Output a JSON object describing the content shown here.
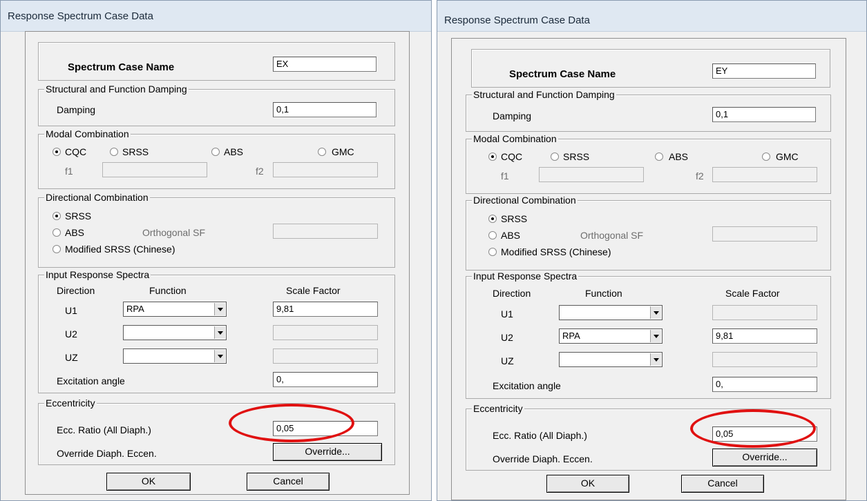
{
  "left_dialog": {
    "title": "Response Spectrum Case Data",
    "case_name_label": "Spectrum Case Name",
    "case_name_value": "EX",
    "damping_group": "Structural and Function Damping",
    "damping_label": "Damping",
    "damping_value": "0,1",
    "modal_group": "Modal Combination",
    "modal_options": [
      "CQC",
      "SRSS",
      "ABS",
      "GMC"
    ],
    "modal_selected": "CQC",
    "f1_label": "f1",
    "f2_label": "f2",
    "directional_group": "Directional Combination",
    "directional_options": [
      "SRSS",
      "ABS",
      "Modified SRSS (Chinese)"
    ],
    "directional_selected": "SRSS",
    "orthogonal_sf_label": "Orthogonal SF",
    "input_group": "Input Response Spectra",
    "col_direction": "Direction",
    "col_function": "Function",
    "col_scale": "Scale Factor",
    "rows": [
      {
        "dir": "U1",
        "function": "RPA",
        "scale": "9,81"
      },
      {
        "dir": "U2",
        "function": "",
        "scale": ""
      },
      {
        "dir": "UZ",
        "function": "",
        "scale": ""
      }
    ],
    "excitation_label": "Excitation  angle",
    "excitation_value": "0,",
    "ecc_group": "Eccentricity",
    "ecc_ratio_label": "Ecc. Ratio (All Diaph.)",
    "ecc_ratio_value": "0,05",
    "override_label": "Override Diaph. Eccen.",
    "override_button": "Override...",
    "ok_button": "OK",
    "cancel_button": "Cancel"
  },
  "right_dialog": {
    "title": "Response Spectrum Case Data",
    "case_name_label": "Spectrum Case Name",
    "case_name_value": "EY",
    "damping_group": "Structural and Function Damping",
    "damping_label": "Damping",
    "damping_value": "0,1",
    "modal_group": "Modal Combination",
    "modal_options": [
      "CQC",
      "SRSS",
      "ABS",
      "GMC"
    ],
    "modal_selected": "CQC",
    "f1_label": "f1",
    "f2_label": "f2",
    "directional_group": "Directional Combination",
    "directional_options": [
      "SRSS",
      "ABS",
      "Modified SRSS (Chinese)"
    ],
    "directional_selected": "SRSS",
    "orthogonal_sf_label": "Orthogonal SF",
    "input_group": "Input Response Spectra",
    "col_direction": "Direction",
    "col_function": "Function",
    "col_scale": "Scale Factor",
    "rows": [
      {
        "dir": "U1",
        "function": "",
        "scale": ""
      },
      {
        "dir": "U2",
        "function": "RPA",
        "scale": "9,81"
      },
      {
        "dir": "UZ",
        "function": "",
        "scale": ""
      }
    ],
    "excitation_label": "Excitation  angle",
    "excitation_value": "0,",
    "ecc_group": "Eccentricity",
    "ecc_ratio_label": "Ecc. Ratio (All Diaph.)",
    "ecc_ratio_value": "0,05",
    "override_label": "Override Diaph. Eccen.",
    "override_button": "Override...",
    "ok_button": "OK",
    "cancel_button": "Cancel"
  },
  "colors": {
    "highlight_ellipse": "#e01010",
    "dialog_bg": "#f0f0f0",
    "titlebar_bg": "#dfe8f2"
  }
}
